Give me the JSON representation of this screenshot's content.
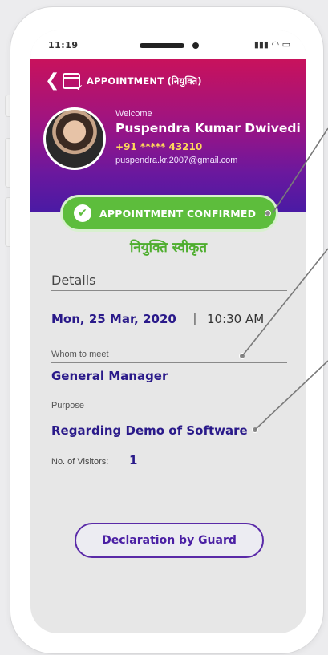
{
  "status_bar": {
    "time": "11:19",
    "icons": "••• ◔ ▬"
  },
  "header": {
    "back_icon": "❮",
    "title": "APPOINTMENT (नियुक्ति)"
  },
  "user": {
    "welcome": "Welcome",
    "name": "Puspendra Kumar Dwivedi",
    "phone": "+91 ***** 43210",
    "email": "puspendra.kr.2007@gmail.com"
  },
  "status": {
    "label": "APPOINTMENT CONFIRMED",
    "hindi": "नियुक्ति स्वीकृत",
    "check_icon": "✔"
  },
  "details": {
    "title": "Details",
    "date": "Mon, 25 Mar, 2020",
    "separator": "|",
    "time": "10:30 AM",
    "whom_label": "Whom to meet",
    "whom_value": "General Manager",
    "purpose_label": "Purpose",
    "purpose_value": "Regarding Demo of Software",
    "visitors_label": "No. of Visitors:",
    "visitors_value": "1"
  },
  "actions": {
    "declaration_label": "Declaration by Guard"
  },
  "colors": {
    "header_top": "#c8125c",
    "header_bottom": "#4a1aa4",
    "confirmed": "#5dbd3c",
    "accent_text": "#2a1a8a",
    "button_border": "#5a2aa8"
  }
}
